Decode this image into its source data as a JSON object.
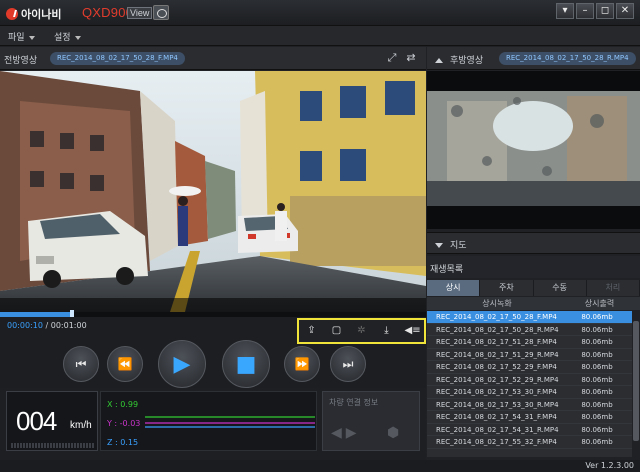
{
  "titlebar": {
    "logo_text": "아이나비",
    "model": "QXD900",
    "view_badge": "View",
    "buttons": [
      "▾",
      "–",
      "◻",
      "✕"
    ]
  },
  "menu": {
    "items": [
      {
        "label": "파일"
      },
      {
        "label": "설정"
      }
    ]
  },
  "front": {
    "label": "전방영상",
    "file": "REC_2014_08_02_17_50_28_F.MP4",
    "elapsed": "00:00:10",
    "total": "/ 00:01:00",
    "progress": 0.17
  },
  "rear": {
    "label": "후방영상",
    "file": "REC_2014_08_02_17_50_28_R.MP4"
  },
  "map": {
    "label": "지도"
  },
  "playlist": {
    "label": "재생목록",
    "tabs": [
      {
        "label": "상시",
        "active": true
      },
      {
        "label": "주차",
        "active": false
      },
      {
        "label": "수동",
        "active": false
      },
      {
        "label": "처리",
        "active": false
      }
    ],
    "columns": [
      "상시녹화",
      "상시출력"
    ],
    "rows": [
      {
        "name": "REC_2014_08_02_17_50_28_F.MP4",
        "size": "80.06mb",
        "selected": true
      },
      {
        "name": "REC_2014_08_02_17_50_28_R.MP4",
        "size": "80.06mb",
        "selected": false
      },
      {
        "name": "REC_2014_08_02_17_51_28_F.MP4",
        "size": "80.06mb",
        "selected": false
      },
      {
        "name": "REC_2014_08_02_17_51_29_R.MP4",
        "size": "80.06mb",
        "selected": false
      },
      {
        "name": "REC_2014_08_02_17_52_29_F.MP4",
        "size": "80.06mb",
        "selected": false
      },
      {
        "name": "REC_2014_08_02_17_52_29_R.MP4",
        "size": "80.06mb",
        "selected": false
      },
      {
        "name": "REC_2014_08_02_17_53_30_F.MP4",
        "size": "80.06mb",
        "selected": false
      },
      {
        "name": "REC_2014_08_02_17_53_30_R.MP4",
        "size": "80.06mb",
        "selected": false
      },
      {
        "name": "REC_2014_08_02_17_54_31_F.MP4",
        "size": "80.06mb",
        "selected": false
      },
      {
        "name": "REC_2014_08_02_17_54_31_R.MP4",
        "size": "80.06mb",
        "selected": false
      },
      {
        "name": "REC_2014_08_02_17_55_32_F.MP4",
        "size": "80.06mb",
        "selected": false
      }
    ]
  },
  "speed": {
    "value": "004",
    "unit": "km/h"
  },
  "gsensor": {
    "x": "X : 0.99",
    "y": "Y : -0.03",
    "z": "Z : 0.15",
    "colors": {
      "x": "#33cc33",
      "y": "#cc33cc",
      "z": "#3aa0ff"
    }
  },
  "vehicle": {
    "title": "차량 연결 정보"
  },
  "version": "Ver 1.2.3.00",
  "colors": {
    "accent": "#3a8fe0",
    "highlight_box": "#f0e43a",
    "brand": "#e23c2d"
  }
}
